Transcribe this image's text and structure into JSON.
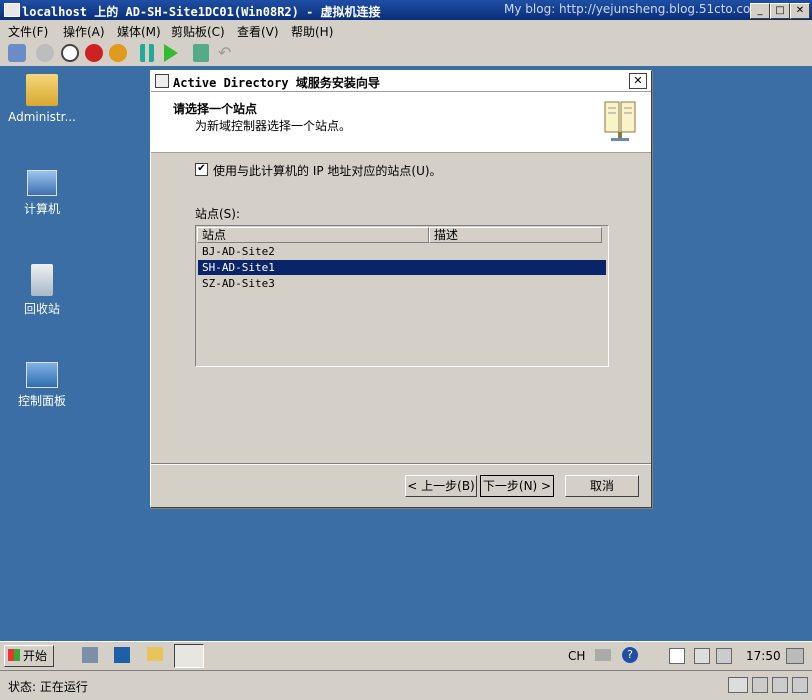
{
  "window": {
    "title": "localhost 上的 AD-SH-Site1DC01(Win08R2) - 虚拟机连接",
    "watermark": "My blog: http://yejunsheng.blog.51cto.com"
  },
  "menubar": [
    {
      "label": "文件(F)"
    },
    {
      "label": "操作(A)"
    },
    {
      "label": "媒体(M)"
    },
    {
      "label": "剪贴板(C)"
    },
    {
      "label": "查看(V)"
    },
    {
      "label": "帮助(H)"
    }
  ],
  "toolbar_icons": [
    "ctrl-alt-del-icon",
    "start-icon",
    "turn-off-icon",
    "shutdown-icon",
    "power-icon",
    "pause-icon",
    "reset-icon",
    "snapshot-icon",
    "revert-icon"
  ],
  "desktop_icons": [
    {
      "name": "administrator-folder",
      "label": "Administr..."
    },
    {
      "name": "computer",
      "label": "计算机"
    },
    {
      "name": "recycle-bin",
      "label": "回收站"
    },
    {
      "name": "control-panel",
      "label": "控制面板"
    }
  ],
  "dialog": {
    "title": "Active Directory 域服务安装向导",
    "header_title": "请选择一个站点",
    "header_subtitle": "为新域控制器选择一个站点。",
    "checkbox_label": "使用与此计算机的 IP 地址对应的站点(U)。",
    "checkbox_checked": true,
    "site_label": "站点(S):",
    "columns": [
      "站点",
      "描述"
    ],
    "sites": [
      "BJ-AD-Site2",
      "SH-AD-Site1",
      "SZ-AD-Site3"
    ],
    "selected_site": "SH-AD-Site1",
    "buttons": {
      "back": "< 上一步(B)",
      "next": "下一步(N) >",
      "cancel": "取消"
    }
  },
  "taskbar": {
    "start_label": "开始",
    "lang": "CH",
    "clock": "17:50"
  },
  "status": {
    "text": "状态: 正在运行"
  },
  "colors": {
    "desktop": "#3a6ea5",
    "titlebar": "#0a2e78",
    "selection": "#0a246a"
  }
}
